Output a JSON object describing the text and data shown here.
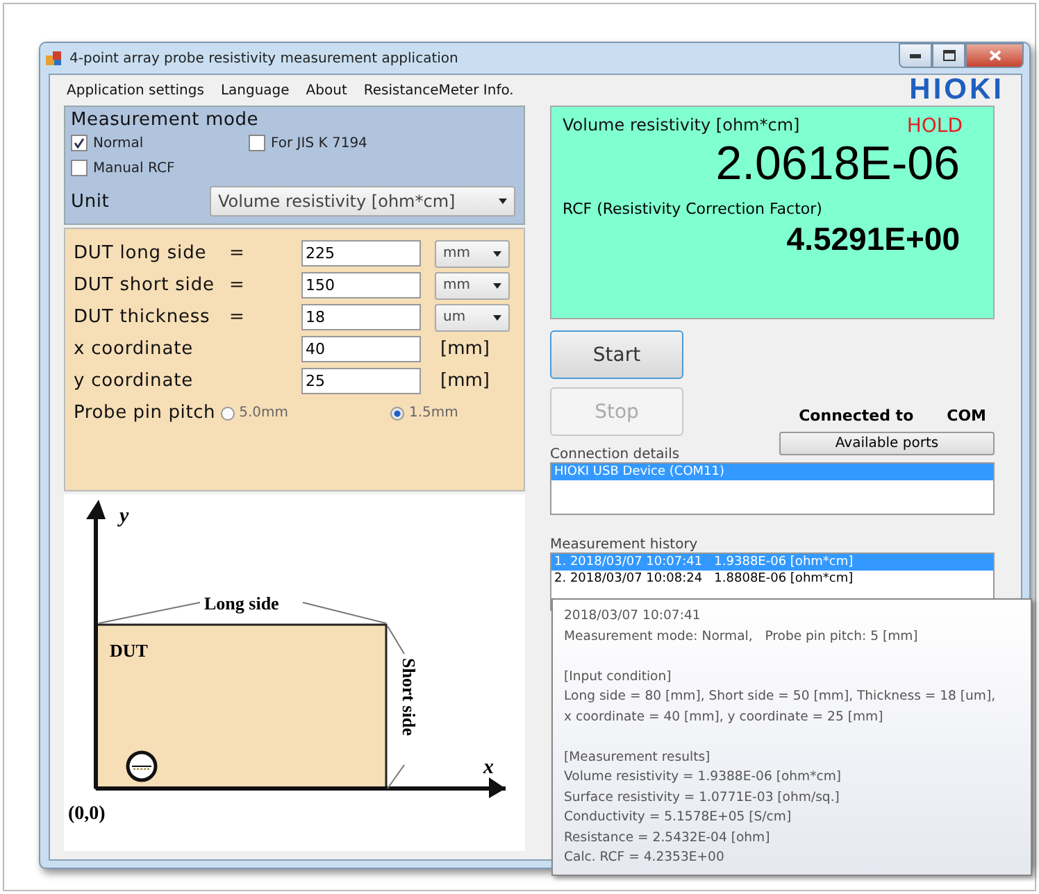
{
  "window": {
    "title": "4-point array probe resistivity measurement application"
  },
  "menu": [
    "Application settings",
    "Language",
    "About",
    "ResistanceMeter Info."
  ],
  "logo": "HIOKI",
  "mode": {
    "title": "Measurement mode",
    "options": [
      {
        "label": "Normal",
        "checked": true
      },
      {
        "label": "For JIS K 7194",
        "checked": false
      },
      {
        "label": "Manual RCF",
        "checked": false
      }
    ],
    "unit_label": "Unit",
    "unit_value": "Volume resistivity [ohm*cm]"
  },
  "inputs": [
    {
      "label": "DUT long side",
      "eq": "=",
      "value": "225",
      "kind": "select",
      "unit": "mm"
    },
    {
      "label": "DUT short side",
      "eq": "=",
      "value": "150",
      "kind": "select",
      "unit": "mm"
    },
    {
      "label": "DUT thickness",
      "eq": "=",
      "value": "18",
      "kind": "select",
      "unit": "um"
    },
    {
      "label": "x coordinate",
      "value": "40",
      "kind": "text",
      "unit": "[mm]"
    },
    {
      "label": "y coordinate",
      "value": "25",
      "kind": "text",
      "unit": "[mm]"
    }
  ],
  "pitch": {
    "label": "Probe pin pitch",
    "options": [
      {
        "label": "5.0mm",
        "selected": false
      },
      {
        "label": "1.5mm",
        "selected": true
      }
    ]
  },
  "diagram": {
    "y_axis": "y",
    "x_axis": "x",
    "long": "Long side",
    "dut": "DUT",
    "short": "Short side",
    "origin": "(0,0)"
  },
  "display": {
    "quantity": "Volume resistivity [ohm*cm]",
    "hold": "HOLD",
    "value": "2.0618E-06",
    "rcf_label": "RCF (Resistivity Correction Factor)",
    "rcf_value": "4.5291E+00"
  },
  "buttons": [
    {
      "label": "Start",
      "disabled": false
    },
    {
      "label": "Stop",
      "disabled": true
    }
  ],
  "connection": {
    "status_label": "Connected to",
    "status_value": "COM",
    "ports_button": "Available ports",
    "details_label": "Connection details",
    "items": [
      {
        "text": "HIOKI USB Device (COM11)",
        "selected": true
      }
    ]
  },
  "history": {
    "label": "Measurement history",
    "items": [
      {
        "text": "1. 2018/03/07 10:07:41   1.9388E-06 [ohm*cm]",
        "selected": true
      },
      {
        "text": "2. 2018/03/07 10:08:24   1.8808E-06 [ohm*cm]",
        "selected": false
      }
    ]
  },
  "tooltip": {
    "sections": [
      [
        "2018/03/07 10:07:41",
        "Measurement mode: Normal,   Probe pin pitch: 5 [mm]"
      ],
      [
        "[Input condition]",
        "Long side = 80 [mm], Short side = 50 [mm], Thickness = 18 [um],",
        "x coordinate = 40 [mm], y coordinate = 25 [mm]"
      ],
      [
        "[Measurement results]",
        "Volume resistivity = 1.9388E-06 [ohm*cm]",
        "Surface resistivity = 1.0771E-03 [ohm/sq.]",
        "Conductivity = 5.1578E+05 [S/cm]",
        "Resistance = 2.5432E-04 [ohm]",
        "Calc. RCF = 4.2353E+00"
      ]
    ]
  }
}
